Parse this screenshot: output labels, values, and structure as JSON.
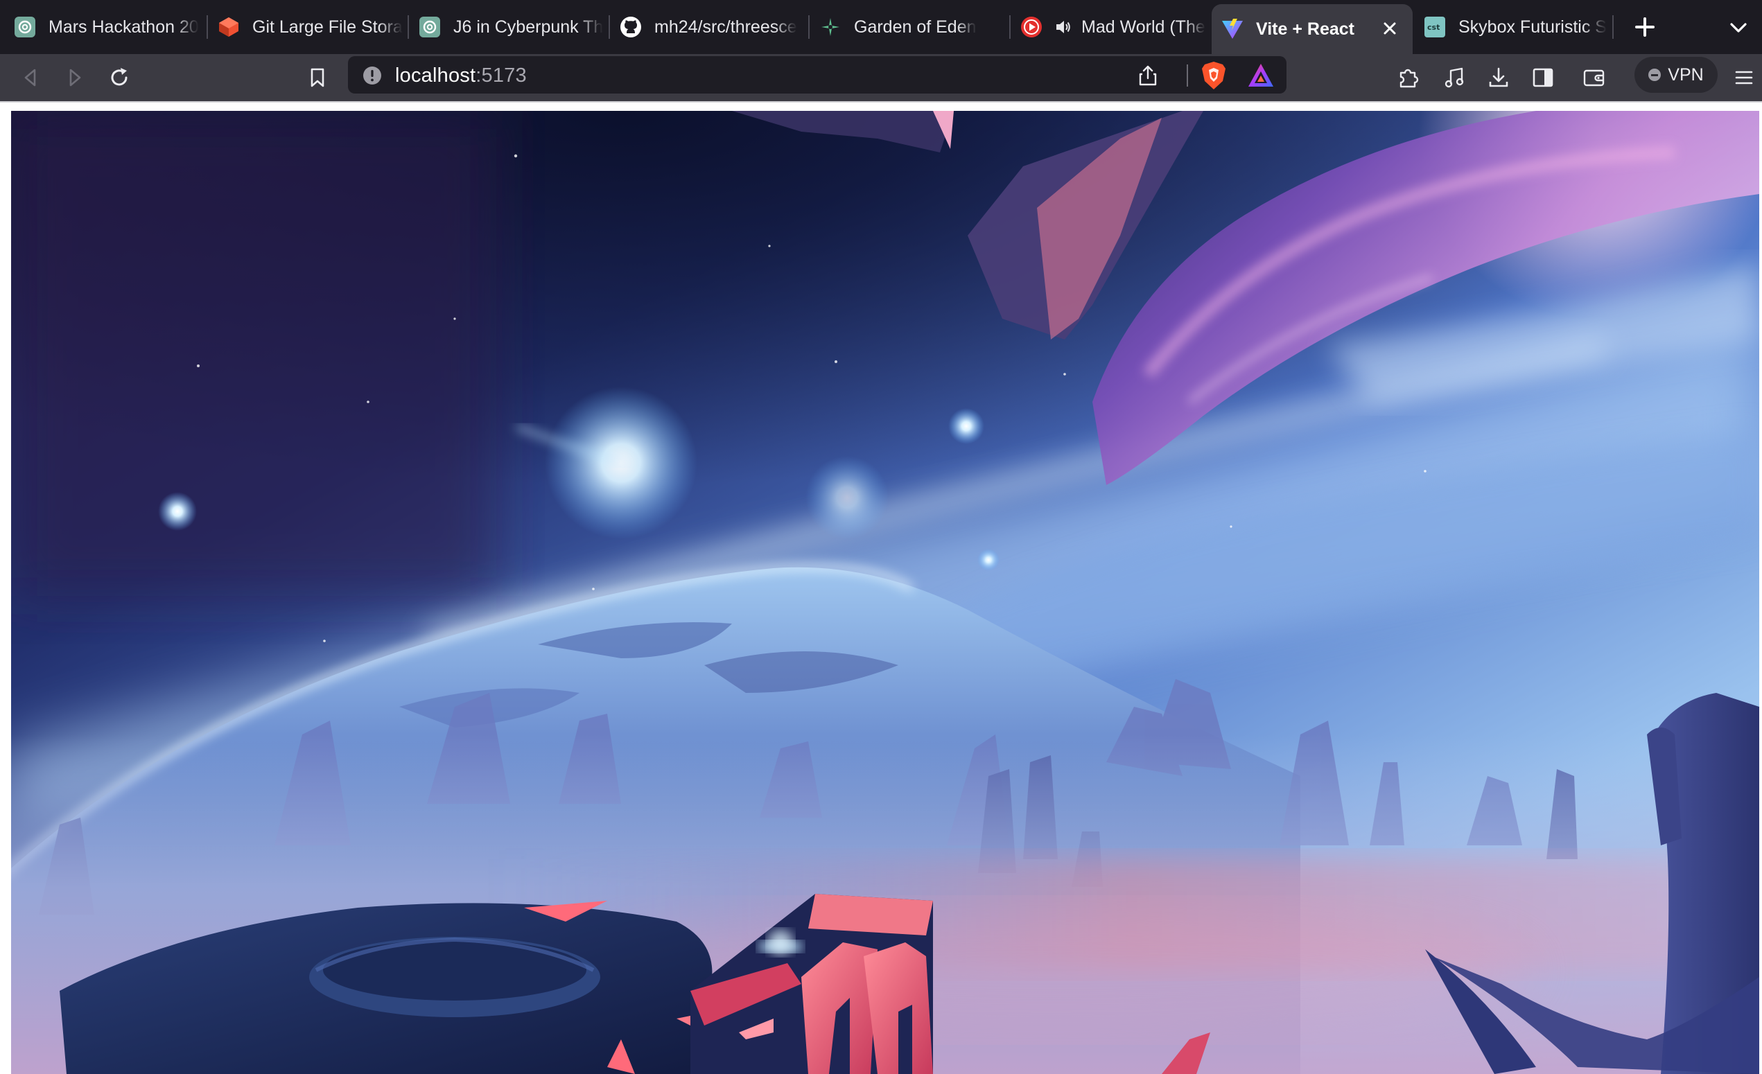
{
  "browser": {
    "tabs": [
      {
        "label": "Mars Hackathon 20",
        "favicon": "openai-icon"
      },
      {
        "label": "Git Large File Stora",
        "favicon": "git-lfs-icon"
      },
      {
        "label": "J6 in Cyberpunk Th",
        "favicon": "openai-icon"
      },
      {
        "label": "mh24/src/threesce",
        "favicon": "github-icon"
      },
      {
        "label": "Garden of Eden",
        "favicon": "garden-leaf-icon"
      },
      {
        "label": "Mad World (The",
        "favicon": "youtube-icon",
        "audio": "speaker-icon"
      },
      {
        "label": "Vite + React",
        "favicon": "vite-icon",
        "active": true
      },
      {
        "label": "Skybox Futuristic S",
        "favicon": "skybox-icon"
      }
    ],
    "address_bar": {
      "host": "localhost",
      "port": ":5173"
    },
    "vpn_label": "VPN",
    "colors": {
      "tabstrip": "#1c1b22",
      "toolbar": "#3b3a42",
      "active_tab": "#3b3a42",
      "brave_orange": "#fb542b"
    }
  },
  "page": {
    "content": "skybox-scene",
    "description_colors": [
      "#0f1436",
      "#3a58b8",
      "#8fbff0",
      "#c8a6d8",
      "#e86a78"
    ]
  }
}
